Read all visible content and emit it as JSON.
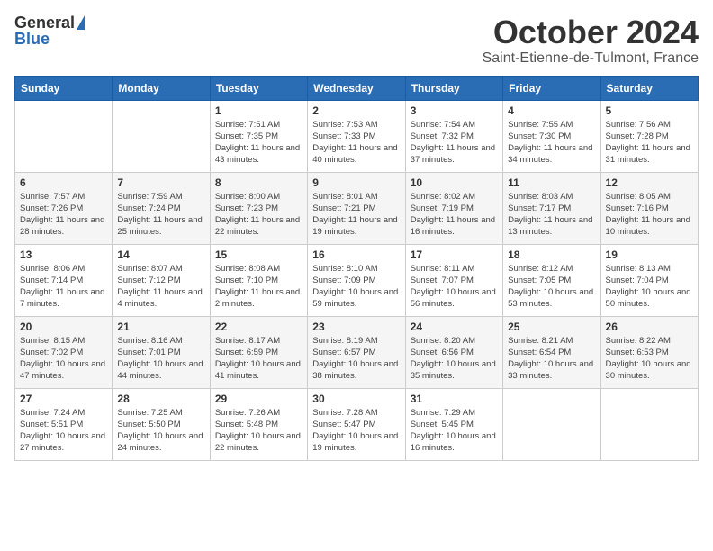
{
  "header": {
    "logo_general": "General",
    "logo_blue": "Blue",
    "month_title": "October 2024",
    "location": "Saint-Etienne-de-Tulmont, France"
  },
  "weekdays": [
    "Sunday",
    "Monday",
    "Tuesday",
    "Wednesday",
    "Thursday",
    "Friday",
    "Saturday"
  ],
  "weeks": [
    [
      {
        "day": "",
        "sunrise": "",
        "sunset": "",
        "daylight": ""
      },
      {
        "day": "",
        "sunrise": "",
        "sunset": "",
        "daylight": ""
      },
      {
        "day": "1",
        "sunrise": "Sunrise: 7:51 AM",
        "sunset": "Sunset: 7:35 PM",
        "daylight": "Daylight: 11 hours and 43 minutes."
      },
      {
        "day": "2",
        "sunrise": "Sunrise: 7:53 AM",
        "sunset": "Sunset: 7:33 PM",
        "daylight": "Daylight: 11 hours and 40 minutes."
      },
      {
        "day": "3",
        "sunrise": "Sunrise: 7:54 AM",
        "sunset": "Sunset: 7:32 PM",
        "daylight": "Daylight: 11 hours and 37 minutes."
      },
      {
        "day": "4",
        "sunrise": "Sunrise: 7:55 AM",
        "sunset": "Sunset: 7:30 PM",
        "daylight": "Daylight: 11 hours and 34 minutes."
      },
      {
        "day": "5",
        "sunrise": "Sunrise: 7:56 AM",
        "sunset": "Sunset: 7:28 PM",
        "daylight": "Daylight: 11 hours and 31 minutes."
      }
    ],
    [
      {
        "day": "6",
        "sunrise": "Sunrise: 7:57 AM",
        "sunset": "Sunset: 7:26 PM",
        "daylight": "Daylight: 11 hours and 28 minutes."
      },
      {
        "day": "7",
        "sunrise": "Sunrise: 7:59 AM",
        "sunset": "Sunset: 7:24 PM",
        "daylight": "Daylight: 11 hours and 25 minutes."
      },
      {
        "day": "8",
        "sunrise": "Sunrise: 8:00 AM",
        "sunset": "Sunset: 7:23 PM",
        "daylight": "Daylight: 11 hours and 22 minutes."
      },
      {
        "day": "9",
        "sunrise": "Sunrise: 8:01 AM",
        "sunset": "Sunset: 7:21 PM",
        "daylight": "Daylight: 11 hours and 19 minutes."
      },
      {
        "day": "10",
        "sunrise": "Sunrise: 8:02 AM",
        "sunset": "Sunset: 7:19 PM",
        "daylight": "Daylight: 11 hours and 16 minutes."
      },
      {
        "day": "11",
        "sunrise": "Sunrise: 8:03 AM",
        "sunset": "Sunset: 7:17 PM",
        "daylight": "Daylight: 11 hours and 13 minutes."
      },
      {
        "day": "12",
        "sunrise": "Sunrise: 8:05 AM",
        "sunset": "Sunset: 7:16 PM",
        "daylight": "Daylight: 11 hours and 10 minutes."
      }
    ],
    [
      {
        "day": "13",
        "sunrise": "Sunrise: 8:06 AM",
        "sunset": "Sunset: 7:14 PM",
        "daylight": "Daylight: 11 hours and 7 minutes."
      },
      {
        "day": "14",
        "sunrise": "Sunrise: 8:07 AM",
        "sunset": "Sunset: 7:12 PM",
        "daylight": "Daylight: 11 hours and 4 minutes."
      },
      {
        "day": "15",
        "sunrise": "Sunrise: 8:08 AM",
        "sunset": "Sunset: 7:10 PM",
        "daylight": "Daylight: 11 hours and 2 minutes."
      },
      {
        "day": "16",
        "sunrise": "Sunrise: 8:10 AM",
        "sunset": "Sunset: 7:09 PM",
        "daylight": "Daylight: 10 hours and 59 minutes."
      },
      {
        "day": "17",
        "sunrise": "Sunrise: 8:11 AM",
        "sunset": "Sunset: 7:07 PM",
        "daylight": "Daylight: 10 hours and 56 minutes."
      },
      {
        "day": "18",
        "sunrise": "Sunrise: 8:12 AM",
        "sunset": "Sunset: 7:05 PM",
        "daylight": "Daylight: 10 hours and 53 minutes."
      },
      {
        "day": "19",
        "sunrise": "Sunrise: 8:13 AM",
        "sunset": "Sunset: 7:04 PM",
        "daylight": "Daylight: 10 hours and 50 minutes."
      }
    ],
    [
      {
        "day": "20",
        "sunrise": "Sunrise: 8:15 AM",
        "sunset": "Sunset: 7:02 PM",
        "daylight": "Daylight: 10 hours and 47 minutes."
      },
      {
        "day": "21",
        "sunrise": "Sunrise: 8:16 AM",
        "sunset": "Sunset: 7:01 PM",
        "daylight": "Daylight: 10 hours and 44 minutes."
      },
      {
        "day": "22",
        "sunrise": "Sunrise: 8:17 AM",
        "sunset": "Sunset: 6:59 PM",
        "daylight": "Daylight: 10 hours and 41 minutes."
      },
      {
        "day": "23",
        "sunrise": "Sunrise: 8:19 AM",
        "sunset": "Sunset: 6:57 PM",
        "daylight": "Daylight: 10 hours and 38 minutes."
      },
      {
        "day": "24",
        "sunrise": "Sunrise: 8:20 AM",
        "sunset": "Sunset: 6:56 PM",
        "daylight": "Daylight: 10 hours and 35 minutes."
      },
      {
        "day": "25",
        "sunrise": "Sunrise: 8:21 AM",
        "sunset": "Sunset: 6:54 PM",
        "daylight": "Daylight: 10 hours and 33 minutes."
      },
      {
        "day": "26",
        "sunrise": "Sunrise: 8:22 AM",
        "sunset": "Sunset: 6:53 PM",
        "daylight": "Daylight: 10 hours and 30 minutes."
      }
    ],
    [
      {
        "day": "27",
        "sunrise": "Sunrise: 7:24 AM",
        "sunset": "Sunset: 5:51 PM",
        "daylight": "Daylight: 10 hours and 27 minutes."
      },
      {
        "day": "28",
        "sunrise": "Sunrise: 7:25 AM",
        "sunset": "Sunset: 5:50 PM",
        "daylight": "Daylight: 10 hours and 24 minutes."
      },
      {
        "day": "29",
        "sunrise": "Sunrise: 7:26 AM",
        "sunset": "Sunset: 5:48 PM",
        "daylight": "Daylight: 10 hours and 22 minutes."
      },
      {
        "day": "30",
        "sunrise": "Sunrise: 7:28 AM",
        "sunset": "Sunset: 5:47 PM",
        "daylight": "Daylight: 10 hours and 19 minutes."
      },
      {
        "day": "31",
        "sunrise": "Sunrise: 7:29 AM",
        "sunset": "Sunset: 5:45 PM",
        "daylight": "Daylight: 10 hours and 16 minutes."
      },
      {
        "day": "",
        "sunrise": "",
        "sunset": "",
        "daylight": ""
      },
      {
        "day": "",
        "sunrise": "",
        "sunset": "",
        "daylight": ""
      }
    ]
  ]
}
